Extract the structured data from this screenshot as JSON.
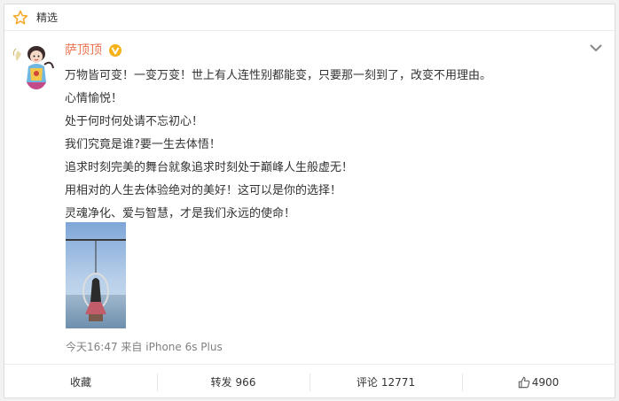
{
  "header": {
    "label": "精选",
    "icon": "star-icon"
  },
  "post": {
    "author": "萨顶顶",
    "verified_icon": "verified-badge-icon",
    "lines": [
      "万物皆可变！一变万变！世上有人连性别都能变，只要那一刻到了，改变不用理由。",
      "心情愉悦！",
      "处于何时何处请不忘初心！",
      "我们究竟是谁?要一生去体悟！",
      "追求时刻完美的舞台就象追求时刻处于巅峰人生般虚无！",
      "用相对的人生去体验绝对的美好！这可以是你的选择！",
      "灵魂净化、爱与智慧，才是我们永远的使命！"
    ],
    "time": "今天16:47",
    "source_prefix": "来自",
    "source": "iPhone 6s Plus"
  },
  "actions": {
    "favorite": "收藏",
    "repost_label": "转发",
    "repost_count": "966",
    "comment_label": "评论",
    "comment_count": "12771",
    "like_icon": "thumbs-up-icon",
    "like_count": "4900"
  },
  "colors": {
    "accent": "#eb7350",
    "star": "#f5a623",
    "link_gray": "#808080"
  }
}
